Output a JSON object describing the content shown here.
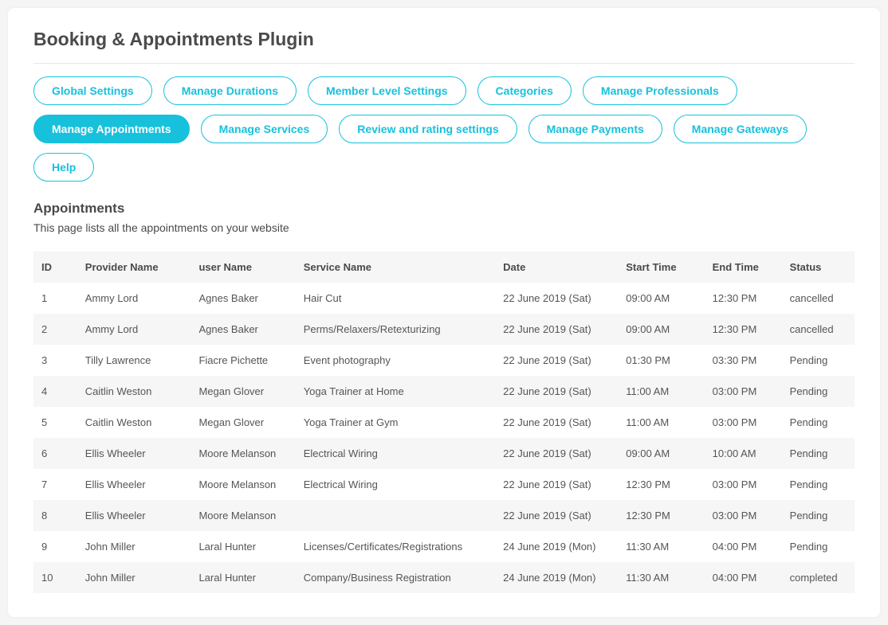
{
  "header": {
    "title": "Booking & Appointments Plugin"
  },
  "tabs": [
    {
      "label": "Global Settings",
      "key": "global-settings",
      "active": false
    },
    {
      "label": "Manage Durations",
      "key": "manage-durations",
      "active": false
    },
    {
      "label": "Member Level Settings",
      "key": "member-level-settings",
      "active": false
    },
    {
      "label": "Categories",
      "key": "categories",
      "active": false
    },
    {
      "label": "Manage Professionals",
      "key": "manage-professionals",
      "active": false
    },
    {
      "label": "Manage Appointments",
      "key": "manage-appointments",
      "active": true
    },
    {
      "label": "Manage Services",
      "key": "manage-services",
      "active": false
    },
    {
      "label": "Review and rating settings",
      "key": "review-rating-settings",
      "active": false
    },
    {
      "label": "Manage Payments",
      "key": "manage-payments",
      "active": false
    },
    {
      "label": "Manage Gateways",
      "key": "manage-gateways",
      "active": false
    },
    {
      "label": "Help",
      "key": "help",
      "active": false
    }
  ],
  "section": {
    "title": "Appointments",
    "description": "This page lists all the appointments on your website"
  },
  "table": {
    "headers": {
      "id": "ID",
      "provider": "Provider Name",
      "user": "user Name",
      "service": "Service Name",
      "date": "Date",
      "start": "Start Time",
      "end": "End Time",
      "status": "Status"
    },
    "rows": [
      {
        "id": "1",
        "provider": "Ammy Lord",
        "user": "Agnes Baker",
        "service": "Hair Cut",
        "date": "22 June 2019 (Sat)",
        "start": "09:00 AM",
        "end": "12:30 PM",
        "status": "cancelled"
      },
      {
        "id": "2",
        "provider": "Ammy Lord",
        "user": "Agnes Baker",
        "service": "Perms/Relaxers/Retexturizing",
        "date": "22 June 2019 (Sat)",
        "start": "09:00 AM",
        "end": "12:30 PM",
        "status": "cancelled"
      },
      {
        "id": "3",
        "provider": "Tilly Lawrence",
        "user": "Fiacre Pichette",
        "service": "Event photography",
        "date": "22 June 2019 (Sat)",
        "start": "01:30 PM",
        "end": "03:30 PM",
        "status": "Pending"
      },
      {
        "id": "4",
        "provider": "Caitlin Weston",
        "user": "Megan Glover",
        "service": "Yoga Trainer at Home",
        "date": "22 June 2019 (Sat)",
        "start": "11:00 AM",
        "end": "03:00 PM",
        "status": "Pending"
      },
      {
        "id": "5",
        "provider": "Caitlin Weston",
        "user": "Megan Glover",
        "service": "Yoga Trainer at Gym",
        "date": "22 June 2019 (Sat)",
        "start": "11:00 AM",
        "end": "03:00 PM",
        "status": "Pending"
      },
      {
        "id": "6",
        "provider": "Ellis Wheeler",
        "user": "Moore Melanson",
        "service": "Electrical Wiring",
        "date": "22 June 2019 (Sat)",
        "start": "09:00 AM",
        "end": "10:00 AM",
        "status": "Pending"
      },
      {
        "id": "7",
        "provider": "Ellis Wheeler",
        "user": "Moore Melanson",
        "service": "Electrical Wiring",
        "date": "22 June 2019 (Sat)",
        "start": "12:30 PM",
        "end": "03:00 PM",
        "status": "Pending"
      },
      {
        "id": "8",
        "provider": "Ellis Wheeler",
        "user": "Moore Melanson",
        "service": "",
        "date": "22 June 2019 (Sat)",
        "start": "12:30 PM",
        "end": "03:00 PM",
        "status": "Pending"
      },
      {
        "id": "9",
        "provider": "John Miller",
        "user": "Laral Hunter",
        "service": "Licenses/Certificates/Registrations",
        "date": "24 June 2019 (Mon)",
        "start": "11:30 AM",
        "end": "04:00 PM",
        "status": "Pending"
      },
      {
        "id": "10",
        "provider": "John Miller",
        "user": "Laral Hunter",
        "service": "Company/Business Registration",
        "date": "24 June 2019 (Mon)",
        "start": "11:30 AM",
        "end": "04:00 PM",
        "status": "completed"
      }
    ]
  }
}
